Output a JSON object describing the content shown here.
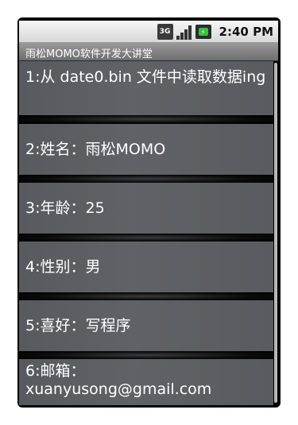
{
  "status_bar": {
    "network_label": "3G",
    "time": "2:40 PM"
  },
  "app": {
    "title": "雨松MOMO软件开发大讲堂"
  },
  "list": {
    "items": [
      {
        "text": "1:从 date0.bin 文件中读取数据ing"
      },
      {
        "text": "2:姓名：雨松MOMO"
      },
      {
        "text": "3:年龄：25"
      },
      {
        "text": "4:性别：男"
      },
      {
        "text": "5:喜好：写程序"
      },
      {
        "text": "6:邮箱：xuanyusong@gmail.com"
      }
    ]
  },
  "icons": [
    "3g-icon",
    "signal-icon",
    "battery-icon"
  ],
  "colors": {
    "list_background": "#5a5d61",
    "status_bar": "#e6e6e6",
    "title_bar": "#808080",
    "battery_green": "#38c23c"
  }
}
